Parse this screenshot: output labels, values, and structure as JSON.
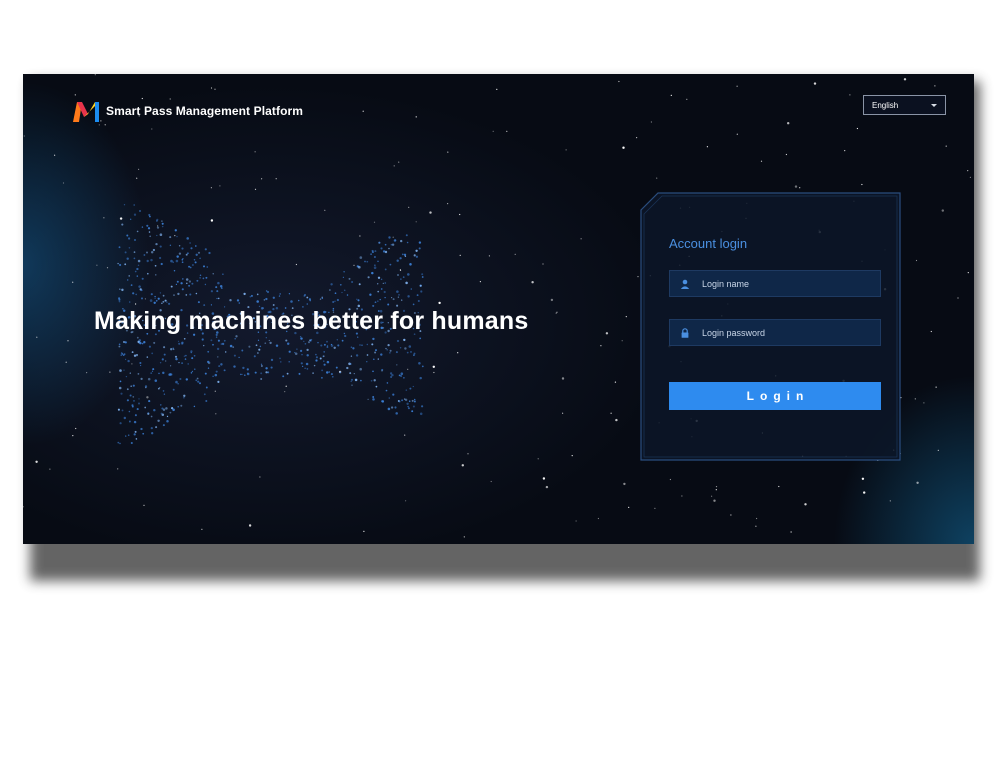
{
  "header": {
    "logo": "m-logo-icon",
    "app_title": "Smart Pass Management Platform"
  },
  "language": {
    "selected": "English",
    "icon": "chevron-down-icon"
  },
  "hero": {
    "tagline": "Making machines better for humans"
  },
  "login": {
    "title": "Account login",
    "username_placeholder": "Login name",
    "password_placeholder": "Login password",
    "username_icon": "user-icon",
    "password_icon": "lock-icon",
    "button_label": "Login"
  },
  "colors": {
    "background": "#070b14",
    "accent": "#2e8bef",
    "panel_title": "#4a8fe0",
    "field_bg": "#0f2748",
    "logo_orange": "#ff7a1a",
    "logo_red": "#e8344b",
    "logo_blue": "#1b8cf0",
    "logo_yellow": "#ffd21f"
  }
}
